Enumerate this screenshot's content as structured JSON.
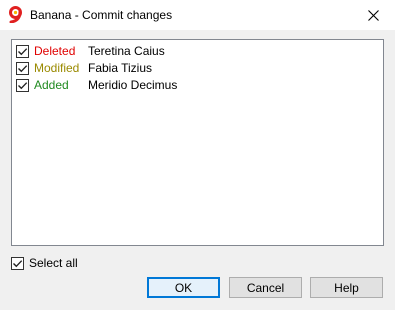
{
  "window": {
    "title": "Banana - Commit changes",
    "icon": "banana-logo-icon",
    "close_icon": "close-icon"
  },
  "colors": {
    "deleted": "#e00000",
    "modified": "#9a8a00",
    "added": "#1f8a1f",
    "accent": "#0078d7"
  },
  "changes": [
    {
      "status": "Deleted",
      "name": "Teretina Caius",
      "checked": true
    },
    {
      "status": "Modified",
      "name": "Fabia Tizius",
      "checked": true
    },
    {
      "status": "Added",
      "name": "Meridio Decimus",
      "checked": true
    }
  ],
  "select_all": {
    "label": "Select all",
    "checked": true
  },
  "buttons": {
    "ok": "OK",
    "cancel": "Cancel",
    "help": "Help"
  }
}
